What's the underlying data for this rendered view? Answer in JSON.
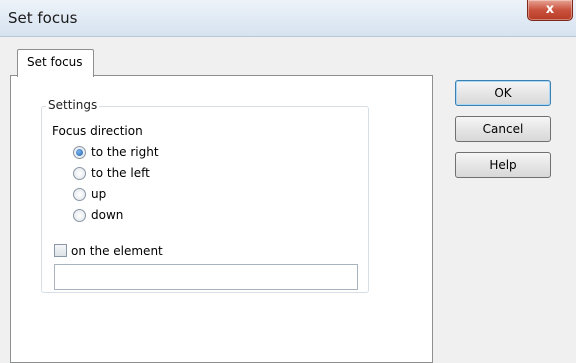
{
  "window": {
    "title": "Set focus",
    "close_glyph": "x"
  },
  "tab": {
    "label": "Set focus"
  },
  "settings": {
    "legend": "Settings",
    "focus_direction_label": "Focus direction",
    "options": [
      {
        "label": "to the right",
        "checked": true
      },
      {
        "label": "to the left",
        "checked": false
      },
      {
        "label": "up",
        "checked": false
      },
      {
        "label": "down",
        "checked": false
      }
    ],
    "on_element_label": "on the element",
    "on_element_checked": false,
    "element_value": ""
  },
  "buttons": {
    "ok": "OK",
    "cancel": "Cancel",
    "help": "Help"
  }
}
